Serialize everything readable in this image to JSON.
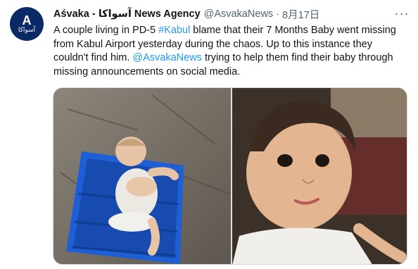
{
  "tweet": {
    "author_name": "Aśvaka - آسواکا News Agency",
    "handle": "@AsvakaNews",
    "separator": "·",
    "date": "8月17日",
    "more_glyph": "···",
    "text_lines": [
      [
        "A couple living in PD-5 ",
        "#Kabul",
        " blame that their 7 Months Baby went missing"
      ],
      [
        "from Kabul Airport yesterday during the chaos. Up to this instance they"
      ],
      [
        "couldn't find him. ",
        "@AsvakaNews",
        " trying to help them find their baby through"
      ],
      [
        "missing announcements on social media."
      ]
    ],
    "avatar_mark": "A",
    "avatar_text": "آسواکا"
  },
  "media": {
    "photos": [
      {
        "name": "photo-baby-in-blue-crate"
      },
      {
        "name": "photo-baby-closeup"
      }
    ]
  },
  "colors": {
    "link": "#1d9bf0",
    "avatar_bg": "#0a2a66",
    "crate": "#1f5fd6"
  }
}
